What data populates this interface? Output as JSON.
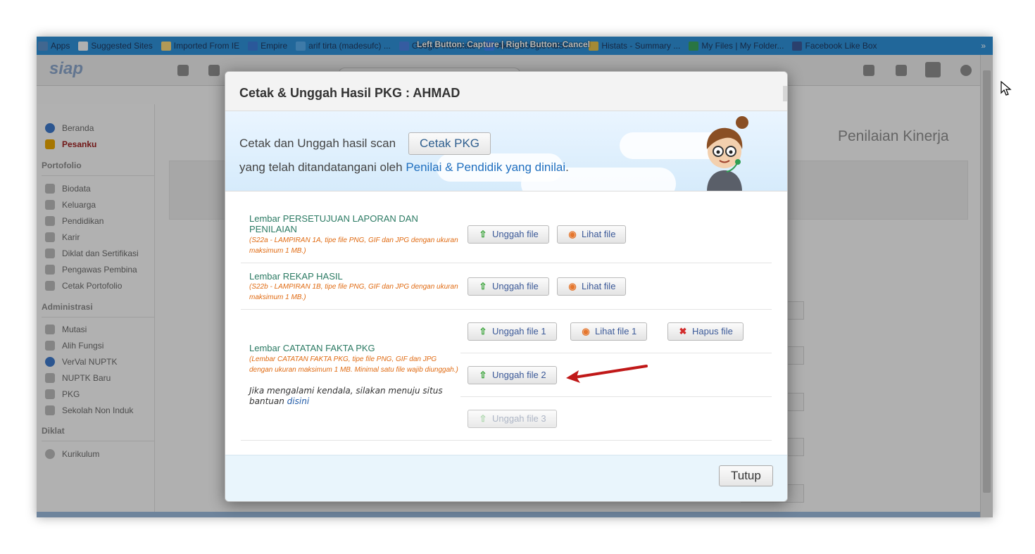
{
  "browser": {
    "bookmarks": [
      {
        "label": "Apps",
        "color": "#5a8fc8"
      },
      {
        "label": "Suggested Sites",
        "color": "#f4f4f4"
      },
      {
        "label": "Imported From IE",
        "color": "#f7d478"
      },
      {
        "label": "Empire",
        "color": "#3b7bd6"
      },
      {
        "label": "arif tirta (madesufc) ...",
        "color": "#56a9e9"
      },
      {
        "label": "Google Translate",
        "color": "#4a80e0"
      },
      {
        "label": "Akun Google AdSen...",
        "color": "#4285f4"
      },
      {
        "label": "Histats - Summary ...",
        "color": "#e4c04a"
      },
      {
        "label": "My Files | My Folder...",
        "color": "#3aa35c"
      },
      {
        "label": "Facebook Like Box",
        "color": "#3b5998"
      }
    ],
    "overflow": "»",
    "capture_hint": "Left Button: Capture | Right Button: Cancel"
  },
  "app": {
    "logo": "siap",
    "page_heading": "Penilaian Kinerja"
  },
  "sidebar": {
    "top_items": [
      {
        "label": "Beranda",
        "icon": "info-icon"
      },
      {
        "label": "Pesanku",
        "icon": "message-alert-icon"
      }
    ],
    "sections": [
      {
        "title": "Portofolio",
        "items": [
          "Biodata",
          "Keluarga",
          "Pendidikan",
          "Karir",
          "Diklat dan Sertifikasi",
          "Pengawas Pembina",
          "Cetak Portofolio"
        ]
      },
      {
        "title": "Administrasi",
        "items": [
          "Mutasi",
          "Alih Fungsi",
          "VerVal NUPTK",
          "NUPTK Baru",
          "PKG",
          "Sekolah Non Induk"
        ]
      },
      {
        "title": "Diklat",
        "items": [
          "Kurikulum"
        ]
      }
    ]
  },
  "modal": {
    "title": "Cetak & Unggah Hasil PKG : AHMAD",
    "banner": {
      "line1": "Cetak dan Unggah hasil scan",
      "print_button": "Cetak PKG",
      "line2_prefix": "yang telah ditandatangani oleh ",
      "line2_link": "Penilai & Pendidik yang dinilai",
      "line2_suffix": "."
    },
    "rows": [
      {
        "label": "Lembar PERSETUJUAN LAPORAN DAN PENILAIAN",
        "hint": "(S22a - LAMPIRAN 1A, tipe file PNG, GIF dan JPG dengan ukuran maksimum 1 MB.)",
        "upload": "Unggah file",
        "view": "Lihat file"
      },
      {
        "label": "Lembar REKAP HASIL",
        "hint": "(S22b - LAMPIRAN 1B, tipe file PNG, GIF dan JPG dengan ukuran maksimum 1 MB.)",
        "upload": "Unggah file",
        "view": "Lihat file"
      },
      {
        "label": "Lembar CATATAN FAKTA PKG",
        "hint": "(Lembar CATATAN FAKTA PKG, tipe file PNG, GIF dan JPG dengan ukuran maksimum 1 MB. Minimal satu file wajib diunggah.)",
        "help_text": "Jika mengalami kendala, silakan menuju situs bantuan ",
        "help_link": "disini",
        "upload1": "Unggah file 1",
        "view1": "Lihat file 1",
        "delete1": "Hapus file",
        "upload2": "Unggah file 2",
        "upload3": "Unggah file 3"
      }
    ],
    "close_button": "Tutup"
  }
}
